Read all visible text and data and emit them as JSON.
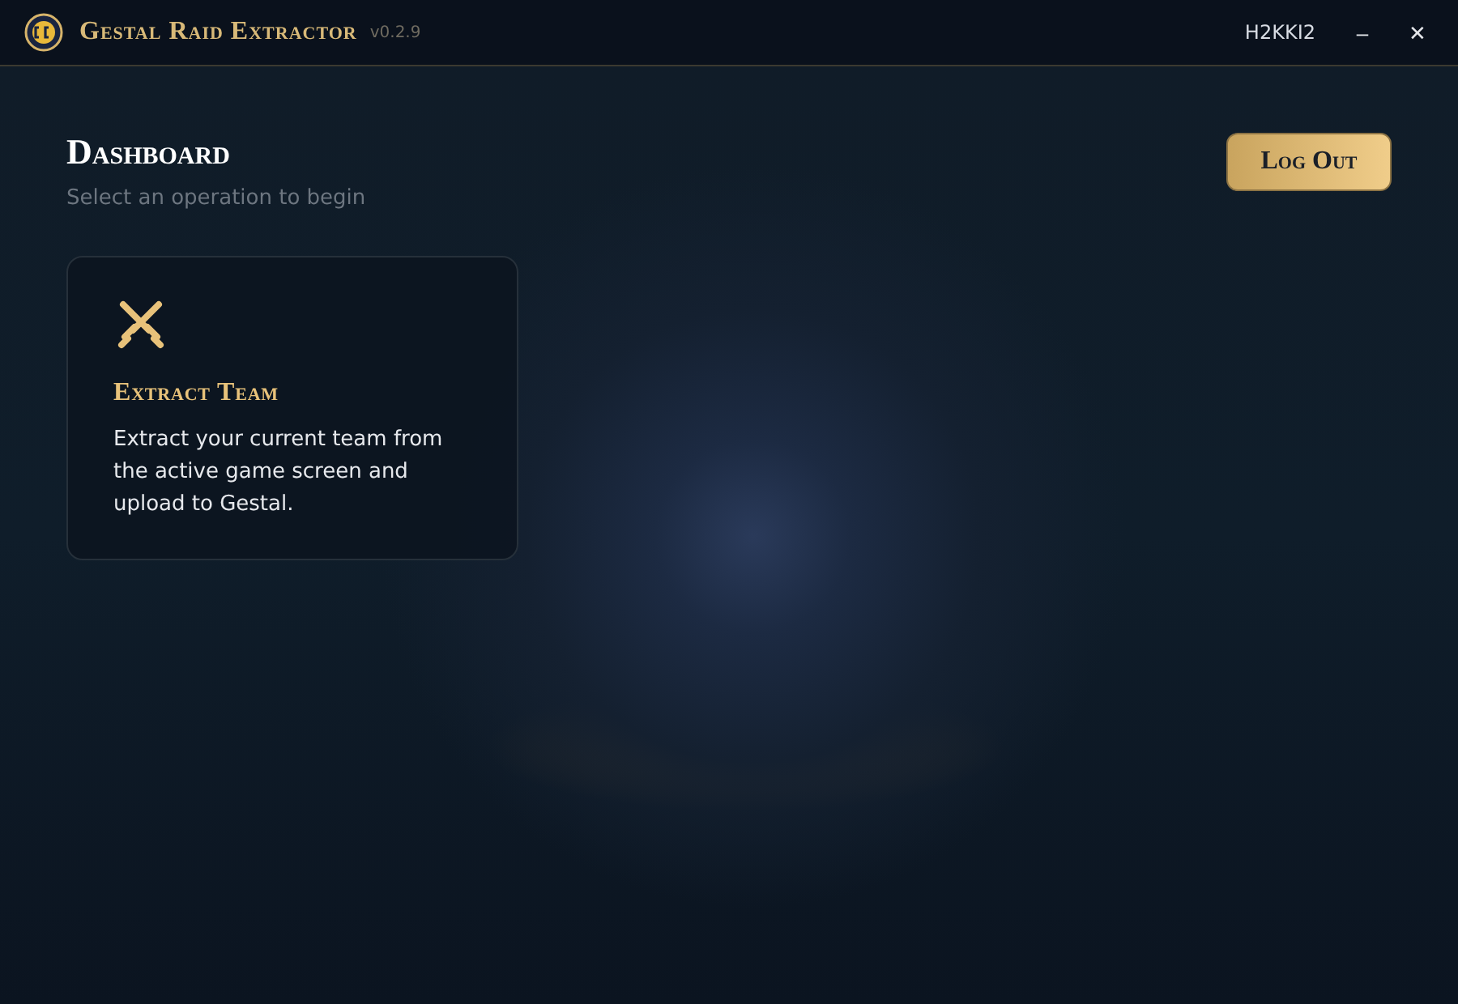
{
  "window": {
    "title": "Gestal Raid Extractor",
    "version": "v0.2.9",
    "user": "H2KKI2",
    "controls": [
      "–",
      "✕"
    ]
  },
  "header": {
    "title": "Dashboard",
    "subtitle": "Select an operation to begin",
    "logout": "Log Out"
  },
  "operations": [
    {
      "kind": "extract",
      "title": "Extract Team",
      "description": "Extract your current team from the active game screen and upload to Gestal."
    }
  ]
}
